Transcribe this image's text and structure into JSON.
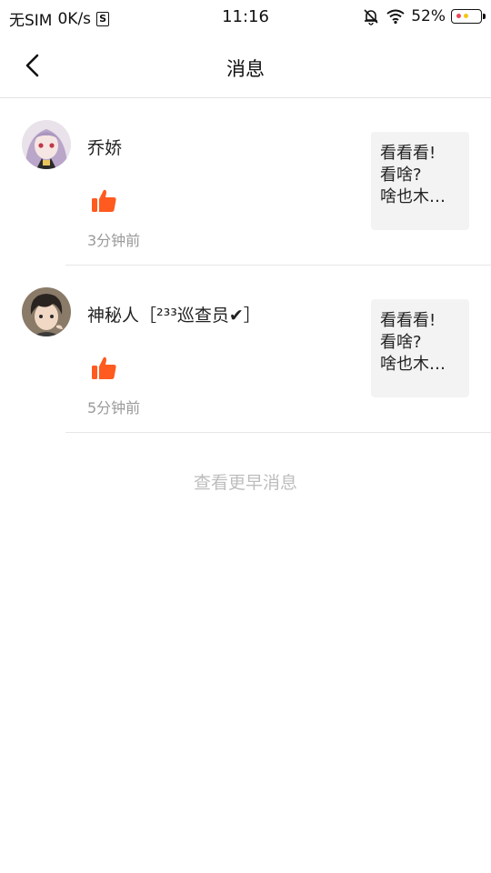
{
  "status_bar": {
    "carrier": "无SIM",
    "speed": "0K/s",
    "sim_icon_glyph": "S",
    "time": "11:16",
    "battery_percent": "52%",
    "icons": [
      "sim-icon",
      "bell-muted-icon",
      "wifi-icon",
      "battery-icon"
    ]
  },
  "header": {
    "title": "消息",
    "back_icon": "chevron-left-icon"
  },
  "messages": [
    {
      "username": "乔娇",
      "action_icon": "thumbs-up-icon",
      "time": "3分钟前",
      "preview": "看看看!\n看啥?\n啥也木…",
      "avatar": "avatar-anime-girl"
    },
    {
      "username": "神秘人［²³³巡查员✔］",
      "action_icon": "thumbs-up-icon",
      "time": "5分钟前",
      "preview": "看看看!\n看啥?\n啥也木…",
      "avatar": "avatar-anime-boy"
    }
  ],
  "load_more": "查看更早消息",
  "colors": {
    "accent": "#ff5a1f",
    "muted_text": "#9a9a9a",
    "preview_bg": "#f3f3f3"
  }
}
